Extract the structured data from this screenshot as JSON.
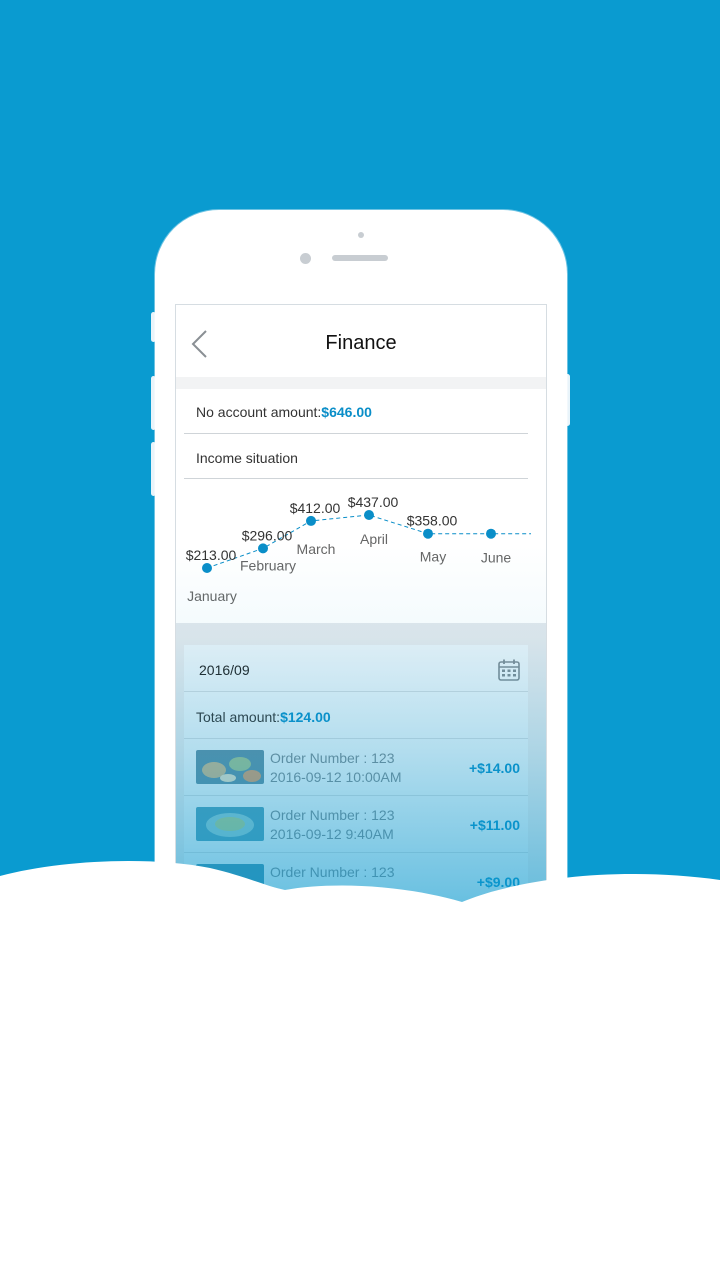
{
  "app": {
    "title": "Finance"
  },
  "summary": {
    "no_account_label": "No account amount:",
    "no_account_value": "$646.00",
    "income_label": "Income situation"
  },
  "chart_data": {
    "type": "line",
    "categories": [
      "January",
      "February",
      "March",
      "April",
      "May",
      "June"
    ],
    "values": [
      213.0,
      296.0,
      412.0,
      437.0,
      358.0,
      null
    ],
    "value_labels": [
      "$213.00",
      "$296.00",
      "$412.00",
      "$437.00",
      "$358.00",
      ""
    ],
    "title": "",
    "xlabel": "",
    "ylabel": "",
    "color": "#0a8ec8"
  },
  "statement": {
    "month": "2016/09",
    "total_label": "Total amount:",
    "total_value": "$124.00",
    "orders": [
      {
        "number": "Order Number : 123",
        "time": "2016-09-12 10:00AM",
        "amount": "+$14.00"
      },
      {
        "number": "Order Number : 123",
        "time": "2016-09-12 9:40AM",
        "amount": "+$11.00"
      },
      {
        "number": "Order Number : 123",
        "time": "",
        "amount": "+$9.00"
      }
    ]
  },
  "icons": {
    "back": "chevron-left-icon",
    "calendar": "calendar-icon"
  },
  "colors": {
    "background": "#0a9bd0",
    "accent": "#0a8ec8"
  }
}
